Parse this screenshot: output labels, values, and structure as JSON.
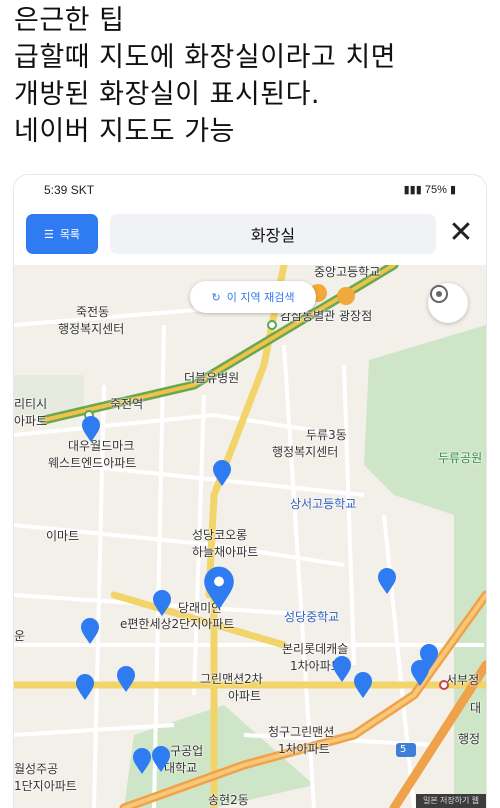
{
  "post": {
    "lines": [
      "은근한 팁",
      "급할때 지도에 화장실이라고 치면",
      "개방된 화장실이 표시된다.",
      "네이버 지도도 가능"
    ]
  },
  "status_bar": {
    "time": "5:39 SKT",
    "battery": "75%"
  },
  "search": {
    "list_button_label": "목록",
    "query": "화장실",
    "close_glyph": "✕"
  },
  "map": {
    "requery_button_label": "이 지역 재검색",
    "labels": {
      "jukjeon_dong": "죽전동",
      "jukjeon_center": "행정복지센터",
      "dublew_hospital": "더블유병원",
      "jukjeon_station": "죽전역",
      "daewoo_mark": "대우월드마크",
      "west_end": "웨스트엔드아파트",
      "emart": "이마트",
      "durew3_dong": "두류3동",
      "durew3_center": "행정복지센터",
      "sangseo_school": "상서고등학교",
      "seongdang_korong": "성당코오롱",
      "haneulchae": "하늘채아파트",
      "dangrae": "당래미안",
      "pyeonhan": "e편한세상2단지아파트",
      "seongdang_middle": "성당중학교",
      "bonri_decastle": "본리롯데캐슬",
      "decastle_apt": "1차아파트",
      "green_mansion_2": "그린맨션2차",
      "green_mansion_2_apt": "아파트",
      "cheonggu_green": "청구그린맨션",
      "cheonggu_apt": "1차아파트",
      "gukgong": "구공업",
      "daehakgyo": "대학교",
      "seobu_station": "서부정",
      "durew_park": "두류공원",
      "gamsam_hall": "감삼동별관 광장점",
      "jungang_high": "중앙고등학교",
      "left_apt1": "리티시",
      "left_apt2": "아파트",
      "left_un": "운",
      "bottom_left1": "월성주공",
      "bottom_left2": "1단지아파트",
      "songhyeon": "송현2동",
      "right_dae": "대",
      "right_haengjeong": "행정",
      "route_5": "5"
    }
  },
  "watermark": "일본 저장하기 웹"
}
